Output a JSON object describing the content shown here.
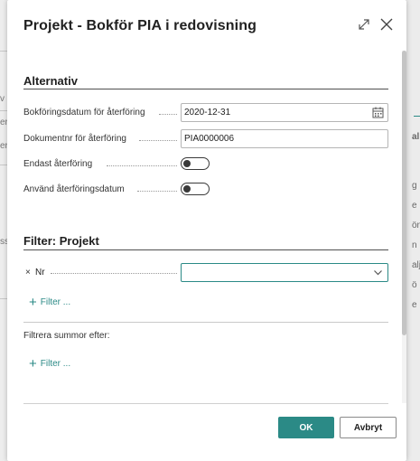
{
  "background": {
    "left_fragments": [
      "v",
      "er",
      "er",
      "ss"
    ],
    "right_fragments": [
      "al",
      "g",
      "e",
      "ön",
      "n",
      "alj",
      "ö",
      "e"
    ]
  },
  "dialog": {
    "title": "Projekt - Bokför PIA i redovisning",
    "icons": {
      "expand": "expand-icon",
      "close": "close-icon"
    }
  },
  "alternativ": {
    "title": "Alternativ",
    "fields": [
      {
        "label": "Bokföringsdatum för återföring",
        "value": "2020-12-31",
        "type": "date"
      },
      {
        "label": "Dokumentnr för återföring",
        "value": "PIA0000006",
        "type": "text"
      },
      {
        "label": "Endast återföring",
        "value": "Nej",
        "type": "toggle"
      },
      {
        "label": "Använd återföringsdatum",
        "value": "Nej",
        "type": "toggle"
      }
    ]
  },
  "filter_projekt": {
    "title": "Filter: Projekt",
    "remove_glyph": "×",
    "field_label": "Nr",
    "field_value": "",
    "add_filter_label": "Filter ..."
  },
  "filter_totals": {
    "title": "Filtrera summor efter:",
    "add_filter_label": "Filter ..."
  },
  "buttons": {
    "ok": "OK",
    "cancel": "Avbryt"
  },
  "colors": {
    "accent": "#2b8a86",
    "text": "#212121",
    "border": "#b5b5b5"
  }
}
